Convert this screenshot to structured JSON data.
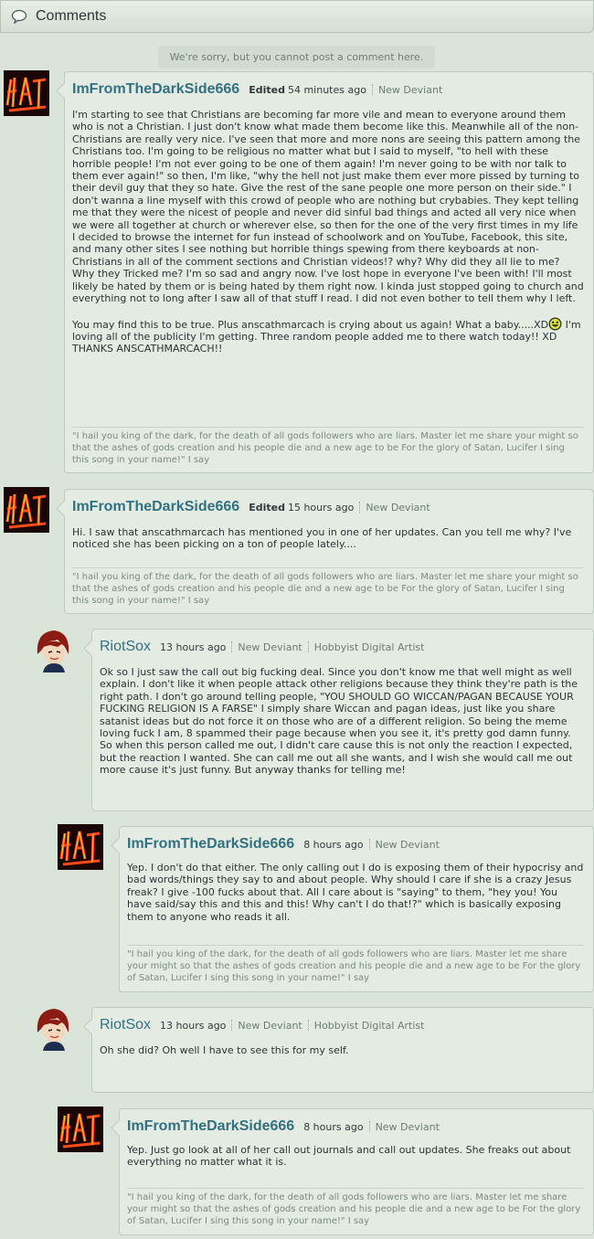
{
  "header": {
    "title": "Comments",
    "icon": "speech-bubble-icon"
  },
  "notice": "We're sorry, but you cannot post a comment here.",
  "comments": [
    {
      "username": "ImFromTheDarkSide666",
      "edited": "Edited",
      "time": "54 minutes ago",
      "roles": [
        "New Deviant"
      ],
      "body": "I'm starting to see that Christians are becoming far more vile and mean to everyone around them who is not a Christian. I just don't know what made them become like this. Meanwhile all of the non-Christians are really very nice. I've seen that more and more nons are seeing this pattern among the Christians too. I'm going to be religious no matter what but I said to myself, \"to hell with these horrible people! I'm not ever going to be one of them again! I'm never going to be with nor talk to them ever again!\" so then, I'm like, \"why the hell not just make them ever more pissed by turning to their devil guy that they so hate. Give the rest of the sane people one more person on their side.\" I don't wanna a line myself with this crowd of people who are nothing but crybabies. They kept telling me that they were the nicest of people and never did sinful bad things and acted all very nice when we were all together at church or wherever else, so then for the one of the very first times in my life I decided to browse the internet for fun instead of schoolwork and on YouTube, Facebook, this site, and many other sites I see nothing but horrible things spewing from there keyboards at non-Christians in all of the comment sections and Christian videos!? why? Why did they all lie to me? Why they Tricked me? I'm so sad and angry now. I've lost hope in everyone I've been with! I'll most likely be hated by them or is being hated by them right now. I kinda just stopped going to church and everything not to long after I saw all of that stuff I read. I did not even bother to tell them why I left.",
      "body2a": "You may find this to be true. Plus anscathmarcach is crying about us again! What a baby.....XD",
      "body2b": " I'm loving all of the publicity I'm getting. Three random people added me to there watch today!! XD THANKS ANSCATHMARCACH!!",
      "signature": "\"I hail you king of the dark, for the death of all gods followers who are liars. Master let me share your might so that the ashes of gods creation and his people die and a new age to be For the glory of Satan, Lucifer I sing this song in your name!\" I say"
    },
    {
      "username": "ImFromTheDarkSide666",
      "edited": "Edited",
      "time": "15 hours ago",
      "roles": [
        "New Deviant"
      ],
      "body": "Hi. I saw that anscathmarcach has mentioned you in one of her updates. Can you tell me why? I've noticed she has been picking on a ton of people lately....",
      "signature": "\"I hail you king of the dark, for the death of all gods followers who are liars. Master let me share your might so that the ashes of gods creation and his people die and a new age to be For the glory of Satan, Lucifer I sing this song in your name!\" I say"
    },
    {
      "username": "RiotSox",
      "time": "13 hours ago",
      "roles": [
        "New Deviant",
        "Hobbyist Digital Artist"
      ],
      "body": "Ok so I just saw the call out big fucking deal. Since you don't know me that well might as well explain. I don't like it when people attack other religions because they think they're path is the right path. I don't go around telling people, \"YOU SHOULD GO WICCAN/PAGAN BECAUSE YOUR FUCKING RELIGION IS A FARSE\" I simply share Wiccan and pagan ideas, just like you share satanist ideas but do not force it on those who are of a different religion. So being the meme loving fuck I am, 8 spammed their page because when you see it, it's pretty god damn funny. So when this person called me out, I didn't care cause this is not only the reaction I expected, but the reaction I wanted. She can call me out all she wants, and I wish she would call me out more cause it's just funny. But anyway thanks for telling me!"
    },
    {
      "username": "ImFromTheDarkSide666",
      "time": "8 hours ago",
      "roles": [
        "New Deviant"
      ],
      "body": "Yep. I don't do that either. The only calling out I do is exposing them of their hypocrisy and bad words/things they say to and about people. Why should I care if she is a crazy Jesus freak? I give -100 fucks about that. All I care about is \"saying\" to them, \"hey you! You have said/say this and this and this! Why can't I do that!?\" which is basically exposing them to anyone who reads it all.",
      "signature": "\"I hail you king of the dark, for the death of all gods followers who are liars. Master let me share your might so that the ashes of gods creation and his people die and a new age to be For the glory of Satan, Lucifer I sing this song in your name!\" I say"
    },
    {
      "username": "RiotSox",
      "time": "13 hours ago",
      "roles": [
        "New Deviant",
        "Hobbyist Digital Artist"
      ],
      "body": "Oh she did? Oh well I have to see this for my self."
    },
    {
      "username": "ImFromTheDarkSide666",
      "time": "8 hours ago",
      "roles": [
        "New Deviant"
      ],
      "body": "Yep. Just go look at all of her call out journals and call out updates. She freaks out about everything no matter what it is.",
      "signature": "\"I hail you king of the dark, for the death of all gods followers who are liars. Master let me share your might so that the ashes of gods creation and his people die and a new age to be For the glory of Satan, Lucifer I sing this song in your name!\" I say"
    }
  ],
  "colors": {
    "username": "#337180",
    "background": "#dae4d9",
    "bubble": "#e3ebe2"
  }
}
